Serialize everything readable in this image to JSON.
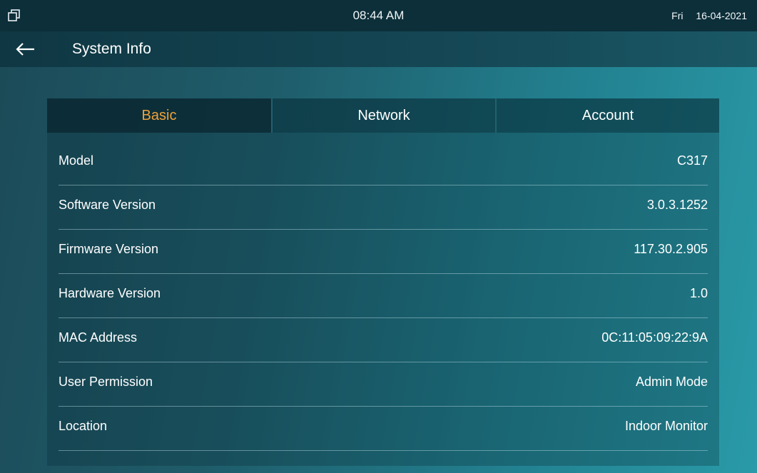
{
  "status_bar": {
    "recent_icon": "recent-apps-icon",
    "time": "08:44 AM",
    "day": "Fri",
    "date": "16-04-2021"
  },
  "header": {
    "back_icon": "back-arrow-icon",
    "title": "System Info"
  },
  "tabs": [
    {
      "label": "Basic",
      "active": true
    },
    {
      "label": "Network",
      "active": false
    },
    {
      "label": "Account",
      "active": false
    }
  ],
  "info_rows": [
    {
      "label": "Model",
      "value": "C317"
    },
    {
      "label": "Software Version",
      "value": "3.0.3.1252"
    },
    {
      "label": "Firmware Version",
      "value": "117.30.2.905"
    },
    {
      "label": "Hardware Version",
      "value": "1.0"
    },
    {
      "label": "MAC Address",
      "value": "0C:11:05:09:22:9A"
    },
    {
      "label": "User Permission",
      "value": "Admin Mode"
    },
    {
      "label": "Location",
      "value": "Indoor Monitor"
    }
  ],
  "colors": {
    "active_tab": "#f0a23a",
    "status_bar": "#0c2f3a",
    "background_start": "#1c4a57",
    "background_end": "#2a9aa8"
  }
}
